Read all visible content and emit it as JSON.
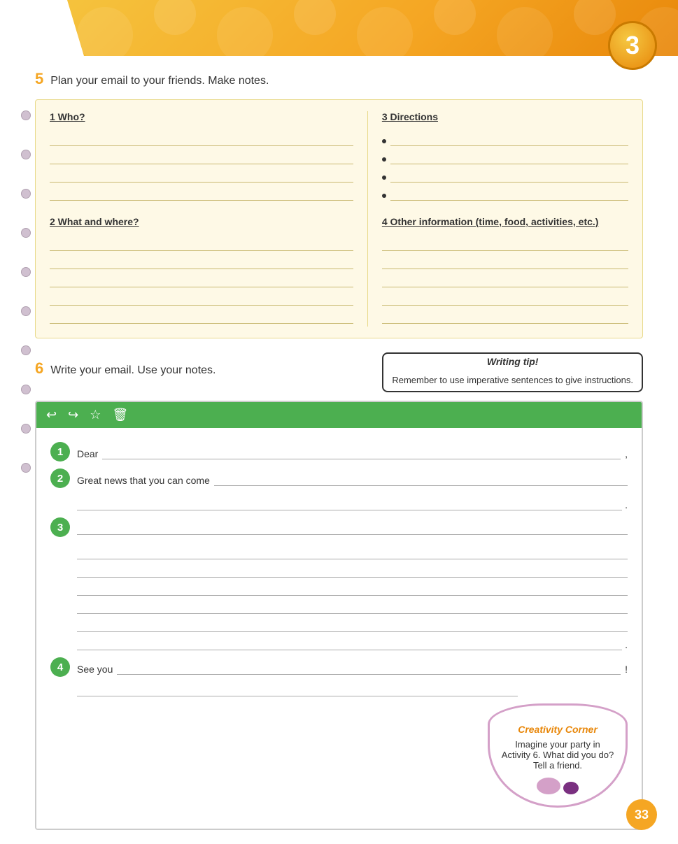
{
  "page": {
    "number": "33",
    "badge_number": "3"
  },
  "header": {
    "alt": "Unit banner"
  },
  "activity5": {
    "number": "5",
    "instruction": "Plan your email to your friends. Make notes.",
    "section1": {
      "title": "1 Who?",
      "lines": 5
    },
    "section2": {
      "title": "2 What and where?",
      "lines": 5
    },
    "section3": {
      "title": "3 Directions",
      "bullets": 4
    },
    "section4": {
      "title": "4 Other information (time, food, activities, etc.)",
      "lines": 5
    }
  },
  "activity6": {
    "number": "6",
    "instruction": "Write your email. Use your notes.",
    "writing_tip": {
      "label": "Writing tip!",
      "text": "Remember to use imperative sentences to give instructions."
    },
    "toolbar": {
      "undo": "↩",
      "redo": "↪",
      "star": "☆",
      "delete": "🗑"
    },
    "paragraph1": {
      "badge": "1",
      "prefix": "Dear",
      "suffix": ","
    },
    "paragraph2": {
      "badge": "2",
      "prefix": "Great news that you can come",
      "period": "."
    },
    "paragraph3": {
      "badge": "3",
      "lines": 7,
      "period": "."
    },
    "paragraph4": {
      "badge": "4",
      "prefix": "See you",
      "suffix": "!"
    }
  },
  "creativity_corner": {
    "title": "Creativity Corner",
    "text": "Imagine your party in Activity 6. What did you do? Tell a friend."
  },
  "rings": [
    "•",
    "•",
    "•",
    "•",
    "•",
    "•",
    "•",
    "•",
    "•",
    "•"
  ]
}
